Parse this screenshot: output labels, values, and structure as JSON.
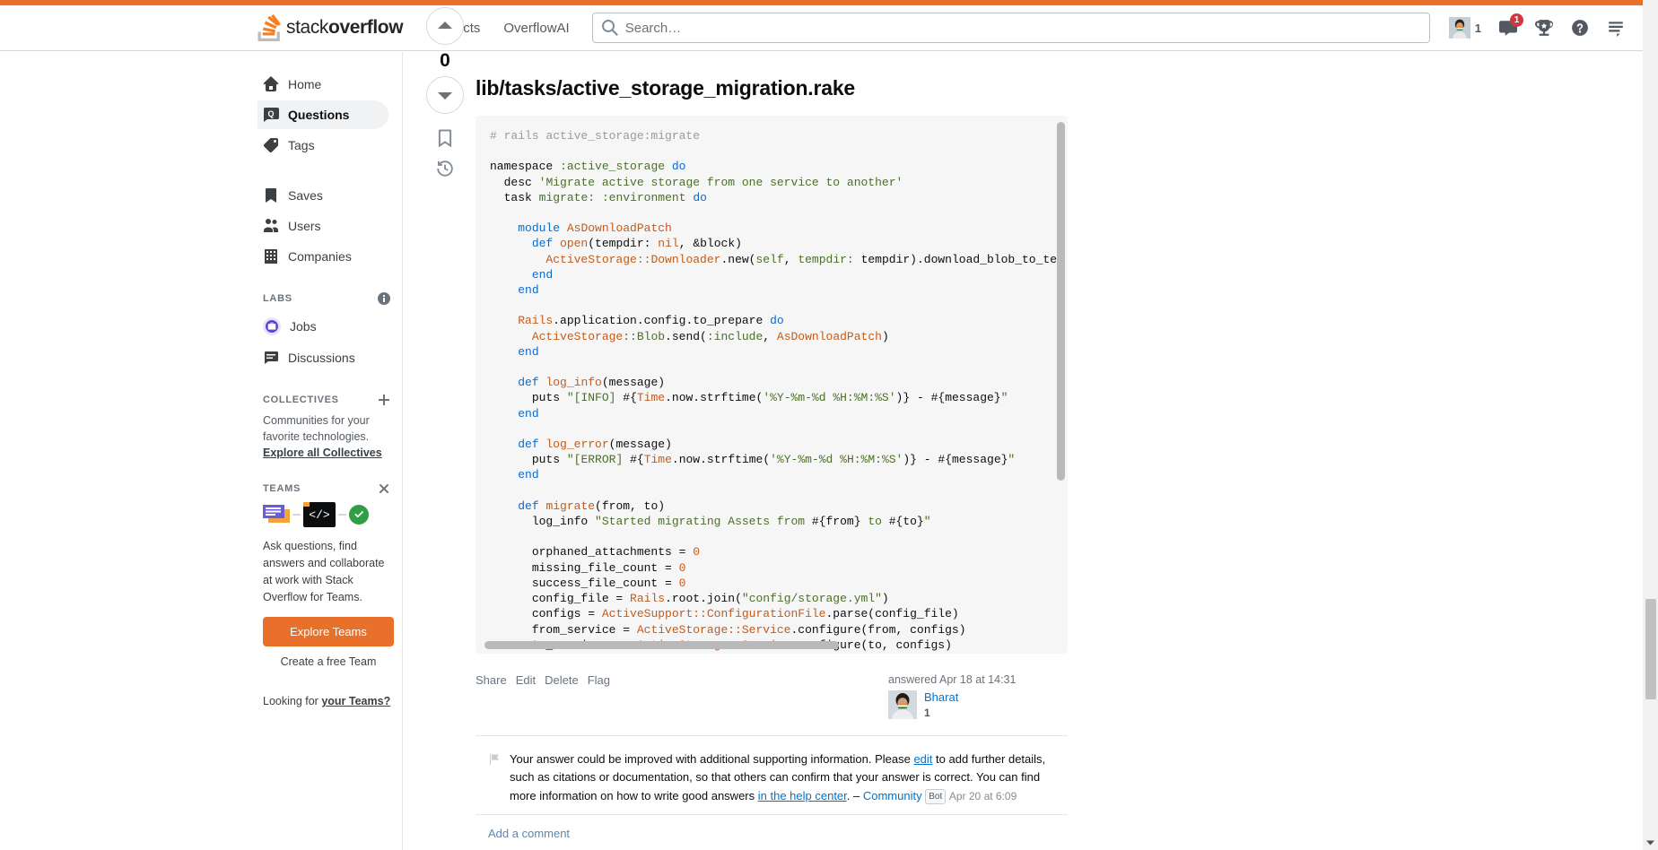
{
  "header": {
    "logo_text_light": "stack",
    "logo_text_bold": "overflow",
    "nav": [
      {
        "label": "Products",
        "name": "nav-products"
      },
      {
        "label": "OverflowAI",
        "name": "nav-overflowai"
      }
    ],
    "search": {
      "placeholder": "Search…",
      "value": "",
      "icon": "search-icon"
    },
    "right": {
      "reputation": "1",
      "inbox_badge": "1",
      "icons": [
        "inbox-icon",
        "trophy-icon",
        "help-icon",
        "hamburger-icon"
      ]
    }
  },
  "sidebar": {
    "primary": [
      {
        "label": "Home",
        "icon": "home-icon",
        "selected": false
      },
      {
        "label": "Questions",
        "icon": "question-icon",
        "selected": true
      },
      {
        "label": "Tags",
        "icon": "tag-icon",
        "selected": false
      }
    ],
    "secondary": [
      {
        "label": "Saves",
        "icon": "bookmark-icon"
      },
      {
        "label": "Users",
        "icon": "users-icon"
      },
      {
        "label": "Companies",
        "icon": "building-icon"
      }
    ],
    "labs": {
      "title": "LABS",
      "info_icon": "info-icon",
      "items": [
        {
          "label": "Jobs",
          "icon": "briefcase-icon"
        },
        {
          "label": "Discussions",
          "icon": "discussion-icon"
        }
      ]
    },
    "collectives": {
      "title": "COLLECTIVES",
      "add_icon": "plus-icon",
      "blurb": "Communities for your favorite technologies.",
      "link": "Explore all Collectives"
    },
    "teams": {
      "title": "TEAMS",
      "close_icon": "close-icon",
      "code_glyph": "</>",
      "copy": "Ask questions, find answers and collaborate at work with Stack Overflow for Teams.",
      "cta": "Explore Teams",
      "create": "Create a free Team",
      "looking_prefix": "Looking for ",
      "looking_link": "your Teams?"
    }
  },
  "post": {
    "vote": {
      "score": "0",
      "up_icon": "arrow-up-icon",
      "down_icon": "arrow-down-icon",
      "bookmark_icon": "bookmark-icon",
      "history_icon": "history-icon"
    },
    "title": "lib/tasks/active_storage_migration.rake",
    "code_lines": [
      {
        "t": "# rails active_storage:migrate",
        "c": "com"
      },
      {
        "t": "",
        "c": "plain"
      },
      {
        "t": "namespace :active_storage do",
        "c": "mix1"
      },
      {
        "t": "  desc 'Migrate active storage from one service to another'",
        "c": "mix2"
      },
      {
        "t": "  task migrate: :environment do",
        "c": "mix3"
      },
      {
        "t": "",
        "c": "plain"
      },
      {
        "t": "    module AsDownloadPatch",
        "c": "mix4"
      },
      {
        "t": "      def open(tempdir: nil, &block)",
        "c": "mix5"
      },
      {
        "t": "        ActiveStorage::Downloader.new(self, tempdir: tempdir).download_blob_to_te",
        "c": "mix6"
      },
      {
        "t": "      end",
        "c": "kw"
      },
      {
        "t": "    end",
        "c": "kw"
      },
      {
        "t": "",
        "c": "plain"
      },
      {
        "t": "    Rails.application.config.to_prepare do",
        "c": "mix7"
      },
      {
        "t": "      ActiveStorage::Blob.send(:include, AsDownloadPatch)",
        "c": "mix8"
      },
      {
        "t": "    end",
        "c": "kw"
      },
      {
        "t": "",
        "c": "plain"
      },
      {
        "t": "    def log_info(message)",
        "c": "mix9"
      },
      {
        "t": "      puts \"[INFO] #{Time.now.strftime('%Y-%m-%d %H:%M:%S')} - #{message}\"",
        "c": "mix10"
      },
      {
        "t": "    end",
        "c": "kw"
      },
      {
        "t": "",
        "c": "plain"
      },
      {
        "t": "    def log_error(message)",
        "c": "mix11"
      },
      {
        "t": "      puts \"[ERROR] #{Time.now.strftime('%Y-%m-%d %H:%M:%S')} - #{message}\"",
        "c": "mix12"
      },
      {
        "t": "    end",
        "c": "kw"
      },
      {
        "t": "",
        "c": "plain"
      },
      {
        "t": "    def migrate(from, to)",
        "c": "mix13"
      },
      {
        "t": "      log_info \"Started migrating Assets from #{from} to #{to}\"",
        "c": "mix14"
      },
      {
        "t": "",
        "c": "plain"
      },
      {
        "t": "      orphaned_attachments = 0",
        "c": "mix15"
      },
      {
        "t": "      missing_file_count = 0",
        "c": "mix16"
      },
      {
        "t": "      success_file_count = 0",
        "c": "mix17"
      },
      {
        "t": "      config_file = Rails.root.join(\"config/storage.yml\")",
        "c": "mix18"
      },
      {
        "t": "      configs = ActiveSupport::ConfigurationFile.parse(config_file)",
        "c": "mix19"
      },
      {
        "t": "      from_service = ActiveStorage::Service.configure(from, configs)",
        "c": "mix20"
      },
      {
        "t": "      to_service   = ActiveStorage::Service.configure(to, configs)",
        "c": "mix21"
      }
    ],
    "actions": [
      "Share",
      "Edit",
      "Delete",
      "Flag"
    ],
    "answered": "answered Apr 18 at 14:31",
    "author": {
      "name": "Bharat",
      "reputation": "1"
    }
  },
  "comments": {
    "items": [
      {
        "flag_icon": "flag-icon",
        "part1": "Your answer could be improved with additional supporting information. Please ",
        "link1": "edit",
        "part2": " to add further details, such as citations or documentation, so that others can confirm that your answer is correct. You can find more information on how to write good answers ",
        "link2": "in the help center",
        "part3": ". – ",
        "author": "Community",
        "bot_tag": "Bot",
        "date": "Apr 20 at 6:09"
      }
    ],
    "add_label": "Add a comment"
  },
  "colors": {
    "accent_orange": "#e8702a",
    "link_blue": "#0074cc",
    "badge_red": "#d1383d",
    "code_bg": "#f6f6f6"
  }
}
